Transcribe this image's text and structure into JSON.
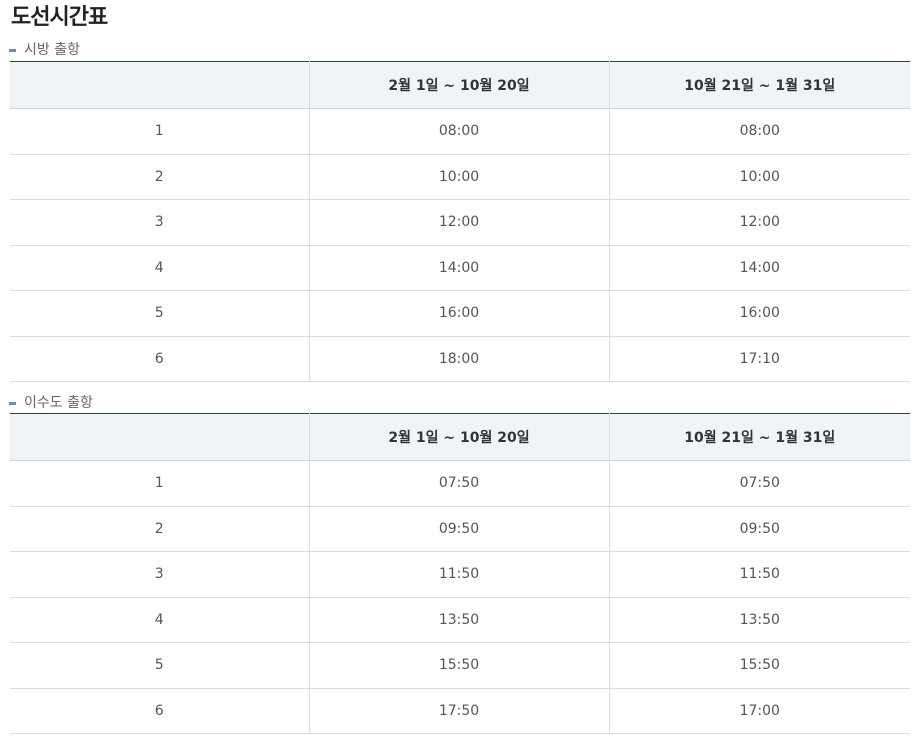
{
  "page": {
    "title": "도선시간표"
  },
  "sections": [
    {
      "title": "시방 출항",
      "headers": [
        "",
        "2월 1일 ~ 10월 20일",
        "10월 21일 ~ 1월 31일"
      ],
      "rows": [
        [
          "1",
          "08:00",
          "08:00"
        ],
        [
          "2",
          "10:00",
          "10:00"
        ],
        [
          "3",
          "12:00",
          "12:00"
        ],
        [
          "4",
          "14:00",
          "14:00"
        ],
        [
          "5",
          "16:00",
          "16:00"
        ],
        [
          "6",
          "18:00",
          "17:10"
        ]
      ]
    },
    {
      "title": "이수도 출항",
      "headers": [
        "",
        "2월 1일 ~ 10월 20일",
        "10월 21일 ~ 1월 31일"
      ],
      "rows": [
        [
          "1",
          "07:50",
          "07:50"
        ],
        [
          "2",
          "09:50",
          "09:50"
        ],
        [
          "3",
          "11:50",
          "11:50"
        ],
        [
          "4",
          "13:50",
          "13:50"
        ],
        [
          "5",
          "15:50",
          "15:50"
        ],
        [
          "6",
          "17:50",
          "17:00"
        ]
      ]
    }
  ]
}
